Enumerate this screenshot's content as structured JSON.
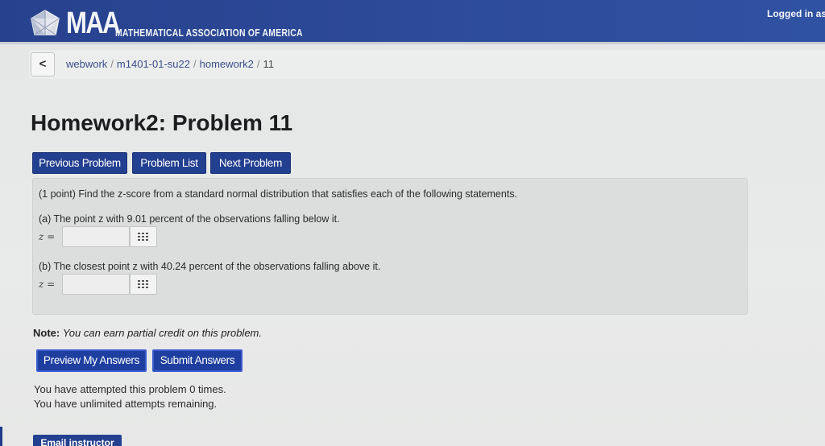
{
  "header": {
    "logo_abbr": "MAA",
    "logo_full": "MATHEMATICAL ASSOCIATION OF AMERICA",
    "logged_in": "Logged in as"
  },
  "breadcrumb": {
    "back": "<",
    "items": [
      "webwork",
      "m1401-01-su22",
      "homework2",
      "11"
    ]
  },
  "page_title": "Homework2: Problem 11",
  "nav": {
    "previous": "Previous Problem",
    "list": "Problem List",
    "next": "Next Problem"
  },
  "problem": {
    "intro": "(1 point) Find the z-score from a standard normal distribution that satisfies each of the following statements.",
    "part_a": "(a) The point z with 9.01 percent of the observations falling below it.",
    "part_b": "(b) The closest point z with 40.24 percent of the observations falling above it.",
    "z_label": "z =",
    "answer_a": "",
    "answer_b": ""
  },
  "note": {
    "label": "Note:",
    "text": "You can earn partial credit on this problem."
  },
  "actions": {
    "preview": "Preview My Answers",
    "submit": "Submit Answers"
  },
  "attempts": {
    "line1": "You have attempted this problem 0 times.",
    "line2": "You have unlimited attempts remaining."
  },
  "email_instructor": "Email instructor",
  "colors": {
    "header": "#2a4690",
    "button": "#233f8f",
    "problem_box": "#dcdedd"
  }
}
